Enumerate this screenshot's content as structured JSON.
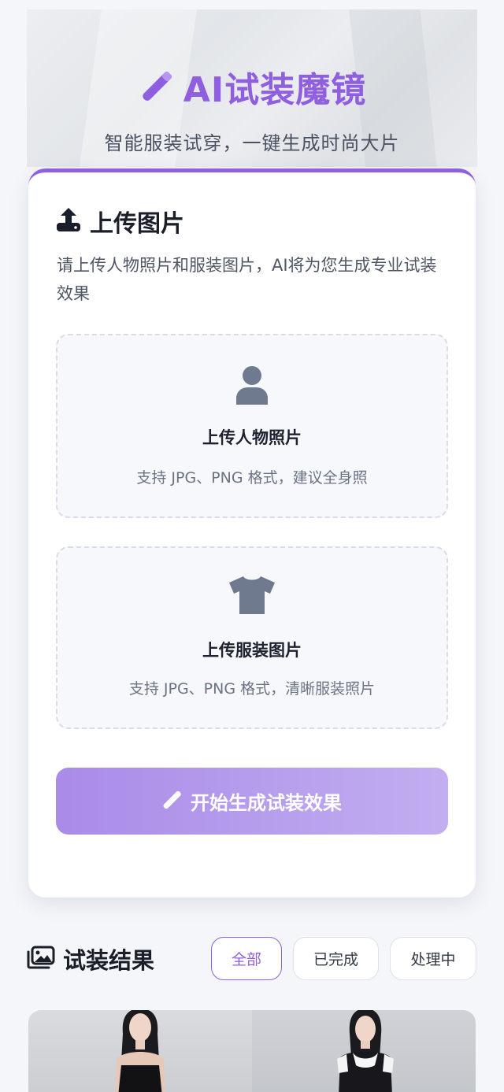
{
  "hero": {
    "title": "AI试装魔镜",
    "subtitle": "智能服装试穿，一键生成时尚大片",
    "icon": "magic-wand-icon"
  },
  "upload": {
    "title": "上传图片",
    "icon": "upload-icon",
    "description": "请上传人物照片和服装图片，AI将为您生成专业试装效果",
    "person": {
      "label": "上传人物照片",
      "hint": "支持 JPG、PNG 格式，建议全身照",
      "icon": "person-icon"
    },
    "clothing": {
      "label": "上传服装图片",
      "hint": "支持 JPG、PNG 格式，清晰服装照片",
      "icon": "tshirt-icon"
    },
    "generate_label": "开始生成试装效果"
  },
  "results": {
    "title": "试装结果",
    "icon": "images-icon",
    "filters": [
      "全部",
      "已完成",
      "处理中"
    ],
    "active_filter": "全部"
  },
  "colors": {
    "accent": "#8f5fe0",
    "button_start": "#a98be8",
    "button_end": "#c2aef0",
    "background": "#f4f6fa"
  }
}
